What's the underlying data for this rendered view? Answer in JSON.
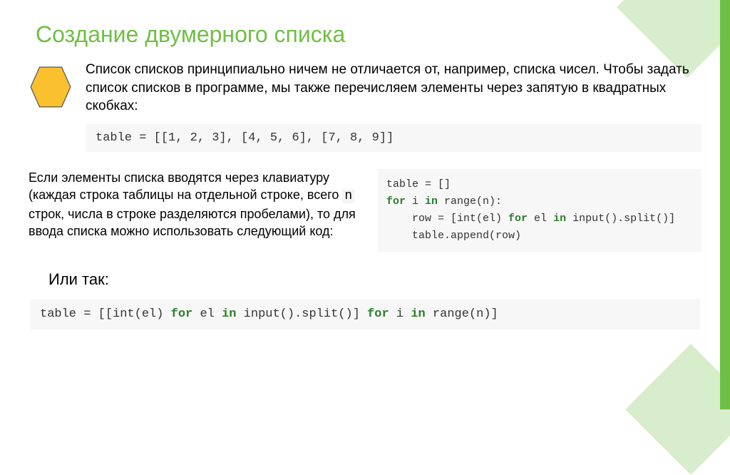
{
  "title": "Создание двумерного списка",
  "paragraph1": "Список списков принципиально ничем не отличается от, например, списка чисел. Чтобы задать список списков в программе, мы также перечисляем элементы через запятую в квадратных скобках:",
  "code1": "table = [[1, 2, 3], [4, 5, 6], [7, 8, 9]]",
  "paragraph2_pre": "Если элементы списка вводятся через клавиатуру (каждая строка таблицы на отдельной строке, всего ",
  "paragraph2_code": "n",
  "paragraph2_post": " строк, числа в строке разделяются пробелами), то для ввода списка можно использовать следующий код:",
  "code2_l1": "table = []",
  "code2_l2a": "for",
  "code2_l2b": " i ",
  "code2_l2c": "in",
  "code2_l2d": " range(n):",
  "code2_l3a": "    row = [int(el) ",
  "code2_l3b": "for",
  "code2_l3c": " el ",
  "code2_l3d": "in",
  "code2_l3e": " input().split()]",
  "code2_l4": "    table.append(row)",
  "or_label": "Или так:",
  "code3_a": "table = [[int(el) ",
  "code3_b": "for",
  "code3_c": " el ",
  "code3_d": "in",
  "code3_e": " input().split()] ",
  "code3_f": "for",
  "code3_g": " i ",
  "code3_h": "in",
  "code3_i": " range(n)]",
  "colors": {
    "accent": "#6fbf44",
    "icon_fill": "#FBC02D"
  }
}
